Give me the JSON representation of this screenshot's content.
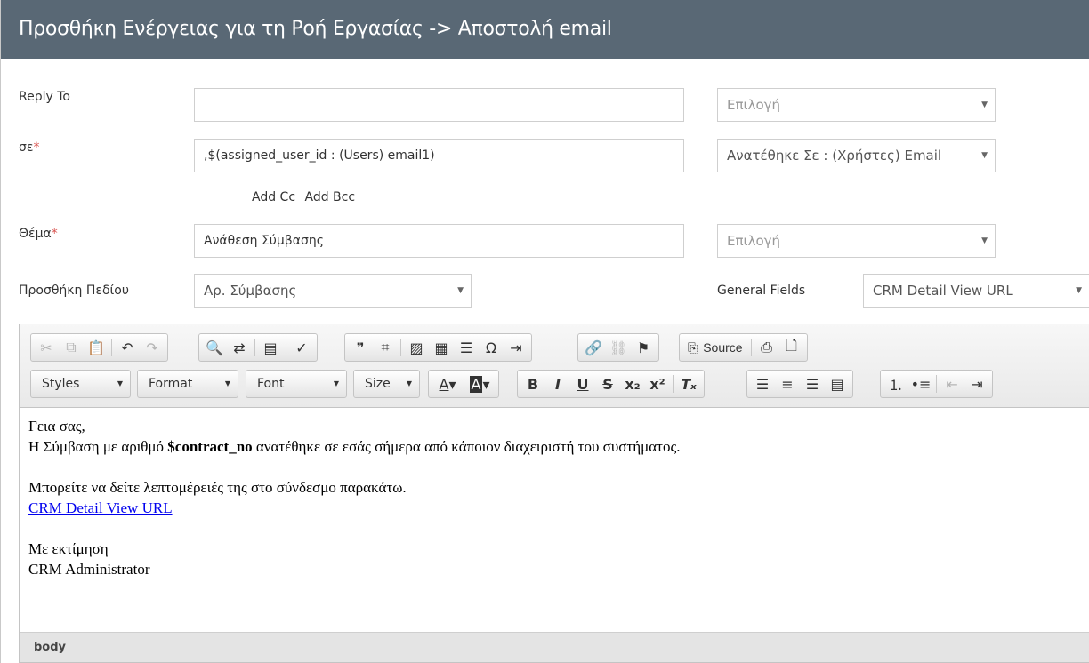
{
  "header": {
    "title": "Προσθήκη Ενέργειας για τη Ροή Εργασίας -> Αποστολή email"
  },
  "form": {
    "reply_to": {
      "label": "Reply To",
      "value": "",
      "select_placeholder": "Επιλογή"
    },
    "to": {
      "label": "σε",
      "required_mark": "*",
      "value": ",$(assigned_user_id : (Users) email1)",
      "select_value": "Ανατέθηκε Σε : (Χρήστες) Email"
    },
    "add_cc": "Add Cc",
    "add_bcc": "Add Bcc",
    "subject": {
      "label": "Θέμα",
      "required_mark": "*",
      "value": "Ανάθεση Σύμβασης",
      "select_placeholder": "Επιλογή"
    },
    "add_field": {
      "label": "Προσθήκη Πεδίου",
      "value": "Αρ. Σύμβασης"
    },
    "general_fields": {
      "label": "General Fields",
      "value": "CRM Detail View URL"
    }
  },
  "editor": {
    "toolbar": {
      "source_label": "Source",
      "styles_label": "Styles",
      "format_label": "Format",
      "font_label": "Font",
      "size_label": "Size"
    },
    "body": {
      "line1": "Γεια σας,",
      "line2_prefix": "Η Σύμβαση με αριθμό ",
      "line2_bold": "$contract_no",
      "line2_suffix": " ανατέθηκε σε εσάς σήμερα από κάποιον διαχειριστή του συστήματος.",
      "line3": "Μπορείτε να δείτε λεπτομέρειές της στο σύνδεσμο παρακάτω.",
      "link": "CRM Detail View URL",
      "closing": "Με εκτίμηση",
      "signature": "CRM Administrator"
    },
    "path": "body"
  }
}
